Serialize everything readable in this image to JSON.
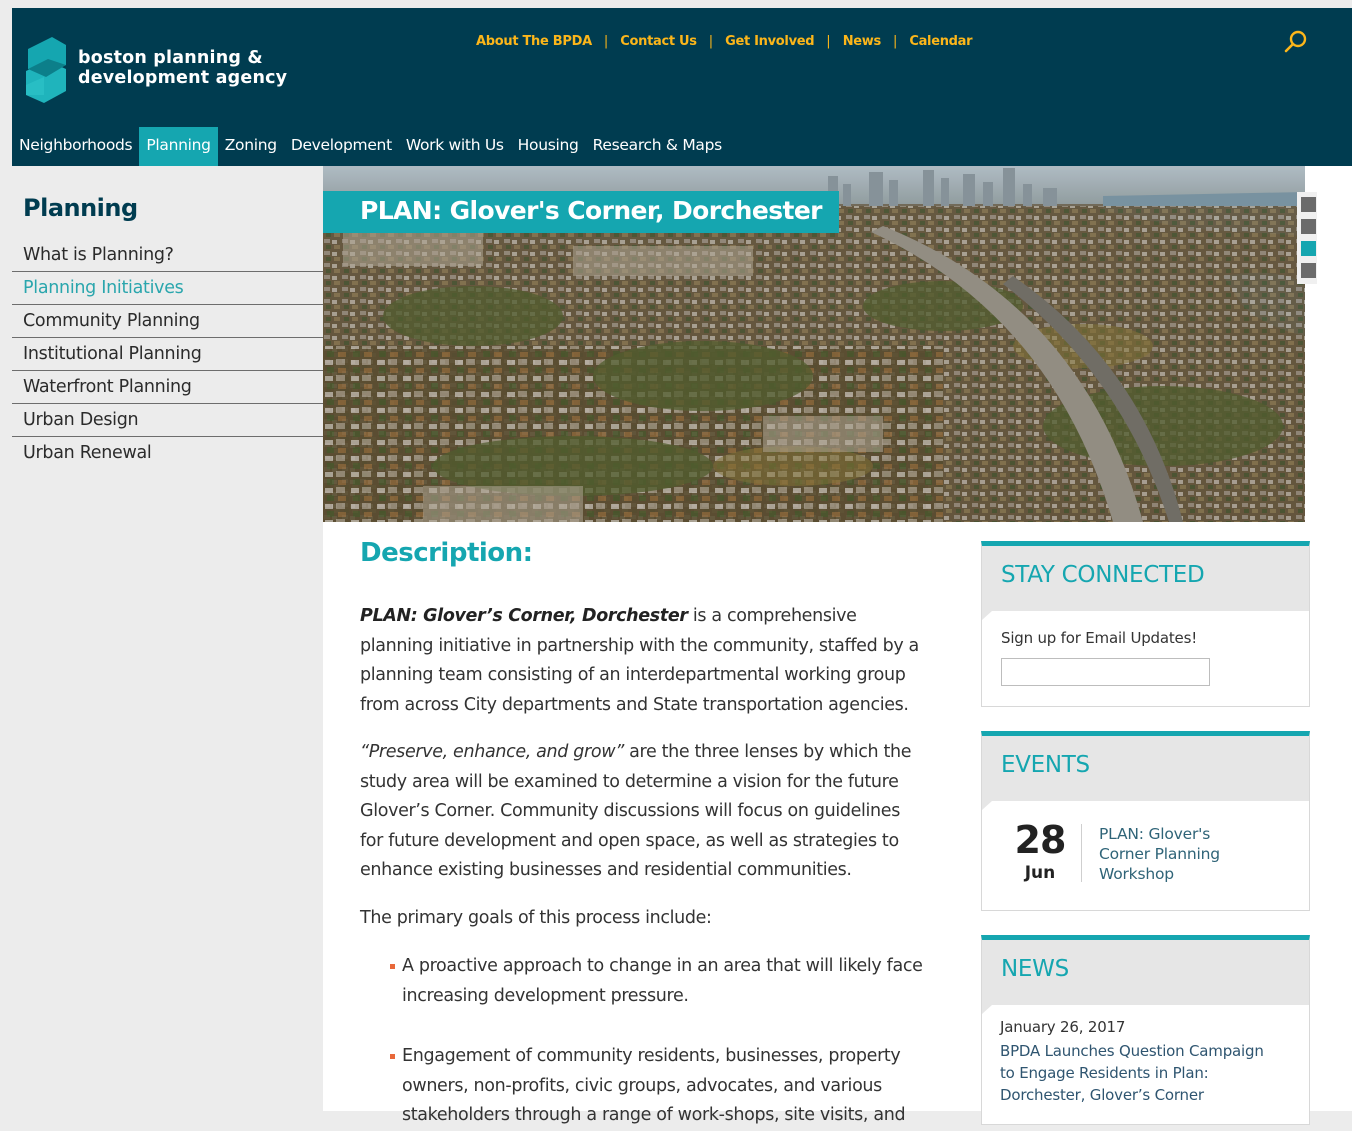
{
  "brand": {
    "name_line1": "boston planning &",
    "name_line2": "development agency",
    "colors": {
      "header_bg": "#003c50",
      "accent": "#15a6b0",
      "utility_link": "#fcb61a",
      "bullet": "#e8683a"
    }
  },
  "utility_nav": {
    "items": [
      "About The BPDA",
      "Contact Us",
      "Get Involved",
      "News",
      "Calendar"
    ],
    "separator": "|"
  },
  "search": {
    "icon": "search-icon"
  },
  "main_nav": {
    "items": [
      "Neighborhoods",
      "Planning",
      "Zoning",
      "Development",
      "Work with Us",
      "Housing",
      "Research & Maps"
    ],
    "active": "Planning"
  },
  "sidebar": {
    "title": "Planning",
    "items": [
      "What is Planning?",
      "Planning Initiatives",
      "Community Planning",
      "Institutional Planning",
      "Waterfront Planning",
      "Urban Design",
      "Urban Renewal"
    ],
    "active": "Planning Initiatives"
  },
  "hero": {
    "title": "PLAN: Glover's Corner, Dorchester",
    "slides_count": 4,
    "active_slide": 3
  },
  "description": {
    "heading": "Description:",
    "p1_lead": "PLAN: Glover’s Corner, Dorchester",
    "p1_rest": " is a comprehensive planning initiative in partnership with the community, staffed by a planning team consisting of an interdepartmental working group from across City departments and State transportation agencies.",
    "p2_lead": "“Preserve, enhance, and grow”",
    "p2_rest": " are the three lenses by which the study area will be examined to determine a vision for the future Glover’s Corner. Community discussions will focus on guidelines for future development and open space, as well as strategies to enhance existing businesses and residential communities.",
    "p3": "The primary goals of this process include:",
    "bullets": [
      "A proactive approach to change in an area that will likely face increasing development pressure.",
      "Engagement of community residents, businesses, property owners, non-profits, civic groups, advocates, and various stakeholders through a range of work-shops, site visits, and"
    ]
  },
  "stay_connected": {
    "heading": "STAY CONNECTED",
    "label": "Sign up for Email Updates!",
    "input_value": "",
    "input_placeholder": ""
  },
  "events": {
    "heading": "EVENTS",
    "day": "28",
    "month": "Jun",
    "title": "PLAN: Glover's Corner Planning Workshop"
  },
  "news": {
    "heading": "NEWS",
    "date": "January 26, 2017",
    "title": "BPDA Launches Question Campaign to Engage Residents in Plan: Dorchester, Glover’s Corner"
  }
}
